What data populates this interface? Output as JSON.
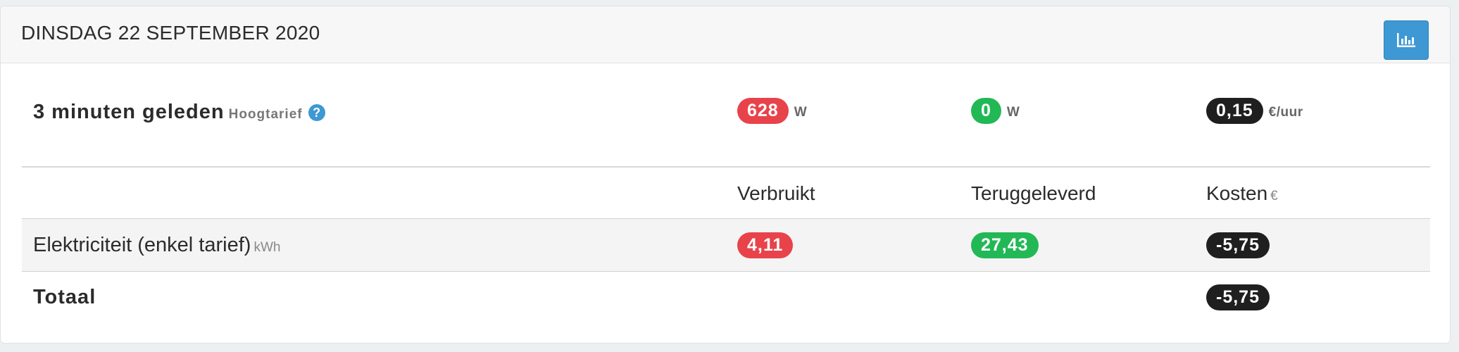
{
  "header": {
    "title": "DINSDAG 22 SEPTEMBER 2020",
    "chart_button_icon": "bar-chart-icon"
  },
  "live": {
    "label": "3 minuten geleden",
    "tariff": "Hoogtarief",
    "help_icon": "?",
    "consumed_value": "628",
    "consumed_unit": "W",
    "returned_value": "0",
    "returned_unit": "W",
    "cost_value": "0,15",
    "cost_unit": "€/uur"
  },
  "table": {
    "columns": {
      "consumed": "Verbruikt",
      "returned": "Teruggeleverd",
      "cost": "Kosten",
      "cost_unit": "€"
    },
    "rows": [
      {
        "label": "Elektriciteit (enkel tarief)",
        "unit": "kWh",
        "consumed": "4,11",
        "returned": "27,43",
        "cost": "-5,75"
      }
    ],
    "total": {
      "label": "Totaal",
      "cost": "-5,75"
    }
  },
  "colors": {
    "consumed": "#e8434a",
    "returned": "#22b856",
    "cost": "#1f1f1f",
    "accent": "#3e98d3"
  }
}
